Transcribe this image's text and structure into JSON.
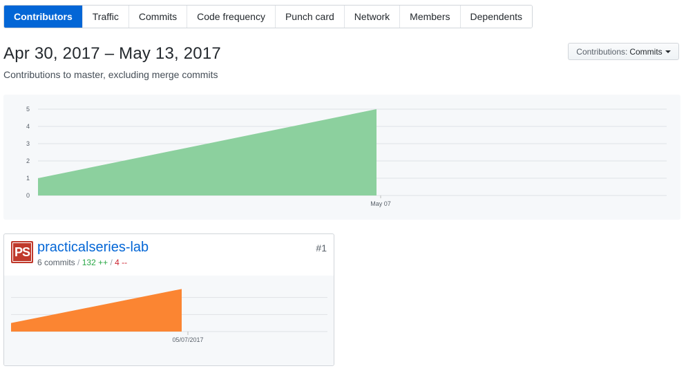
{
  "tabs": [
    {
      "label": "Contributors",
      "active": true
    },
    {
      "label": "Traffic",
      "active": false
    },
    {
      "label": "Commits",
      "active": false
    },
    {
      "label": "Code frequency",
      "active": false
    },
    {
      "label": "Punch card",
      "active": false
    },
    {
      "label": "Network",
      "active": false
    },
    {
      "label": "Members",
      "active": false
    },
    {
      "label": "Dependents",
      "active": false
    }
  ],
  "header": {
    "date_range": "Apr 30, 2017 – May 13, 2017",
    "subtitle": "Contributions to master, excluding merge commits"
  },
  "contributions_select": {
    "prefix": "Contributions:",
    "value": "Commits"
  },
  "colors": {
    "accent": "#0366d6",
    "main_area": "#8cd09e",
    "contributor_area": "#fb8532"
  },
  "chart_data": [
    {
      "type": "area",
      "x": [
        "Apr 30",
        "May 07"
      ],
      "values": [
        1,
        5
      ],
      "xtick_labels": [
        "May 07"
      ],
      "yticks": [
        0,
        1,
        2,
        3,
        4,
        5
      ],
      "ylim": [
        0,
        5
      ],
      "grid": true,
      "color": "#8cd09e"
    },
    {
      "type": "area",
      "x": [
        "04/30/2017",
        "05/07/2017"
      ],
      "values": [
        1,
        5
      ],
      "xtick_labels": [
        "05/07/2017"
      ],
      "ylim": [
        0,
        6
      ],
      "grid": true,
      "color": "#fb8532"
    }
  ],
  "contributor": {
    "avatar_text": "PS",
    "name": "practicalseries-lab",
    "rank": "#1",
    "commits": "6 commits",
    "additions": "132 ++",
    "deletions": "4 --",
    "separator": "/"
  }
}
